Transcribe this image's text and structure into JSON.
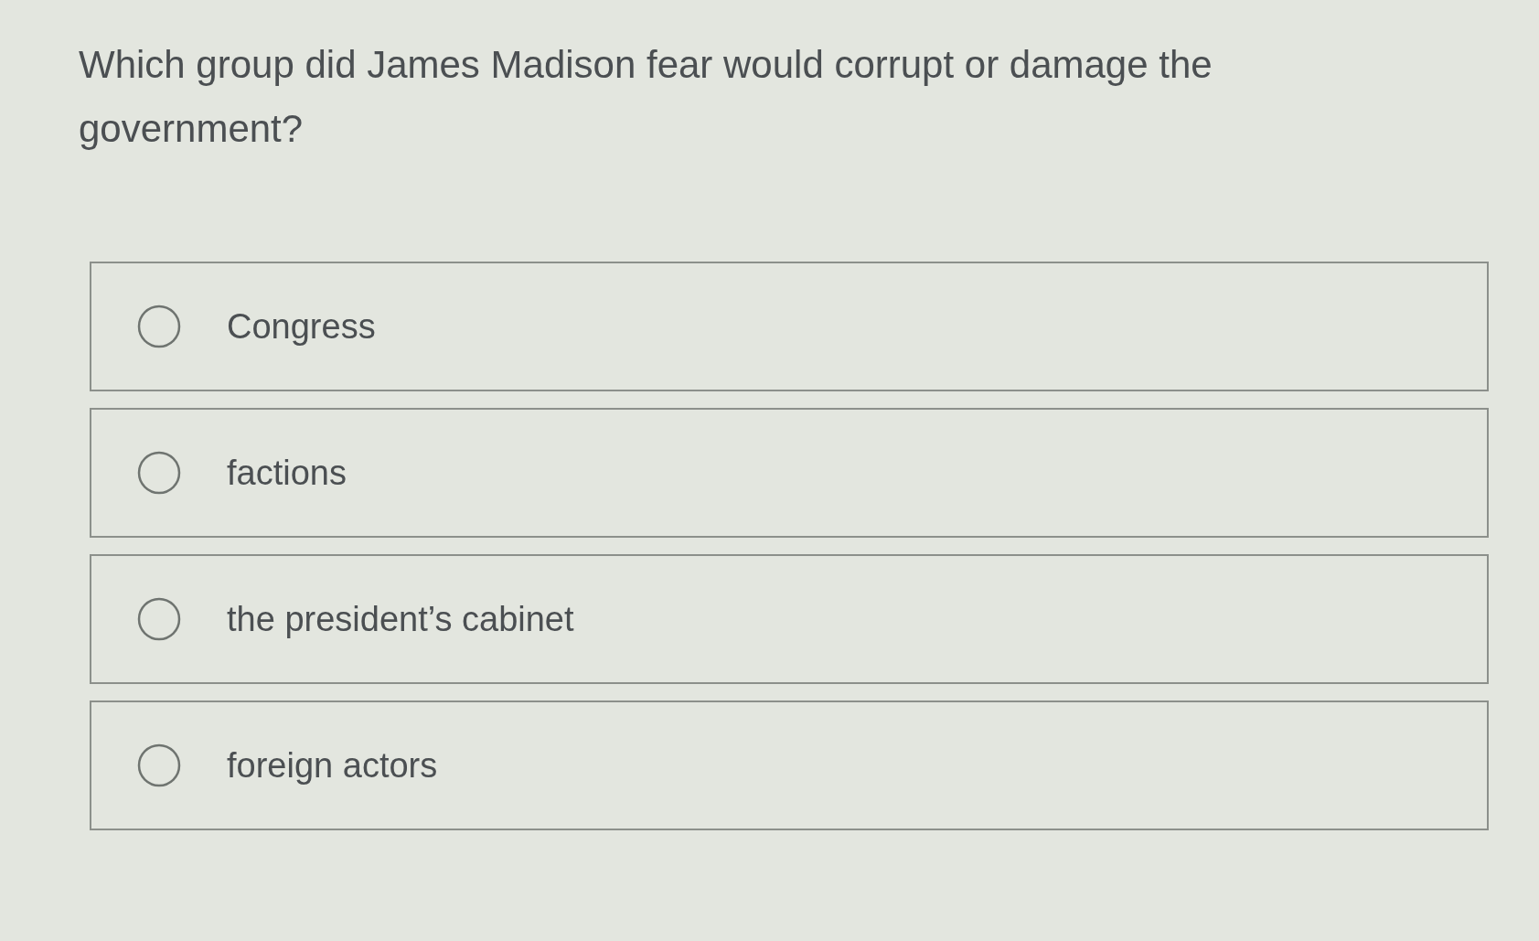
{
  "question": "Which group did James Madison fear would corrupt or damage the government?",
  "options": [
    {
      "label": "Congress",
      "selected": false
    },
    {
      "label": "factions",
      "selected": false
    },
    {
      "label": "the president’s cabinet",
      "selected": false
    },
    {
      "label": "foreign actors",
      "selected": false
    }
  ]
}
